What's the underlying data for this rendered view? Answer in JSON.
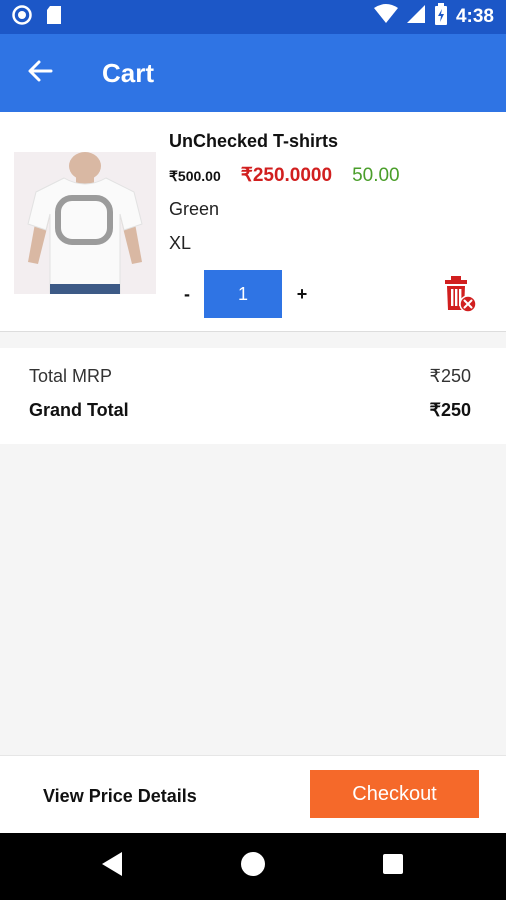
{
  "status_bar": {
    "time": "4:38",
    "icons": [
      "record-icon",
      "sd-card-icon",
      "wifi-icon",
      "signal-icon",
      "battery-icon"
    ]
  },
  "app_bar": {
    "title": "Cart",
    "back_icon": "arrow-left-icon"
  },
  "cart_item": {
    "name": "UnChecked T-shirts",
    "mrp": "₹500.00",
    "price": "₹250.0000",
    "discount": "50.00",
    "color": "Green",
    "size": "XL",
    "quantity": "1",
    "minus_label": "-",
    "plus_label": "+",
    "delete_icon": "trash-remove-icon"
  },
  "totals": {
    "mrp_label": "Total MRP",
    "mrp_value": "₹250",
    "grand_label": "Grand Total",
    "grand_value": "₹250"
  },
  "footer": {
    "details_label": "View Price Details",
    "checkout_label": "Checkout"
  },
  "nav": {
    "icons": [
      "back-triangle-icon",
      "home-circle-icon",
      "recents-square-icon"
    ]
  },
  "colors": {
    "status_bar": "#1c57c7",
    "app_bar": "#2f74e4",
    "sale_price": "#d11f1f",
    "discount": "#4a9e2a",
    "checkout": "#f5692a"
  }
}
